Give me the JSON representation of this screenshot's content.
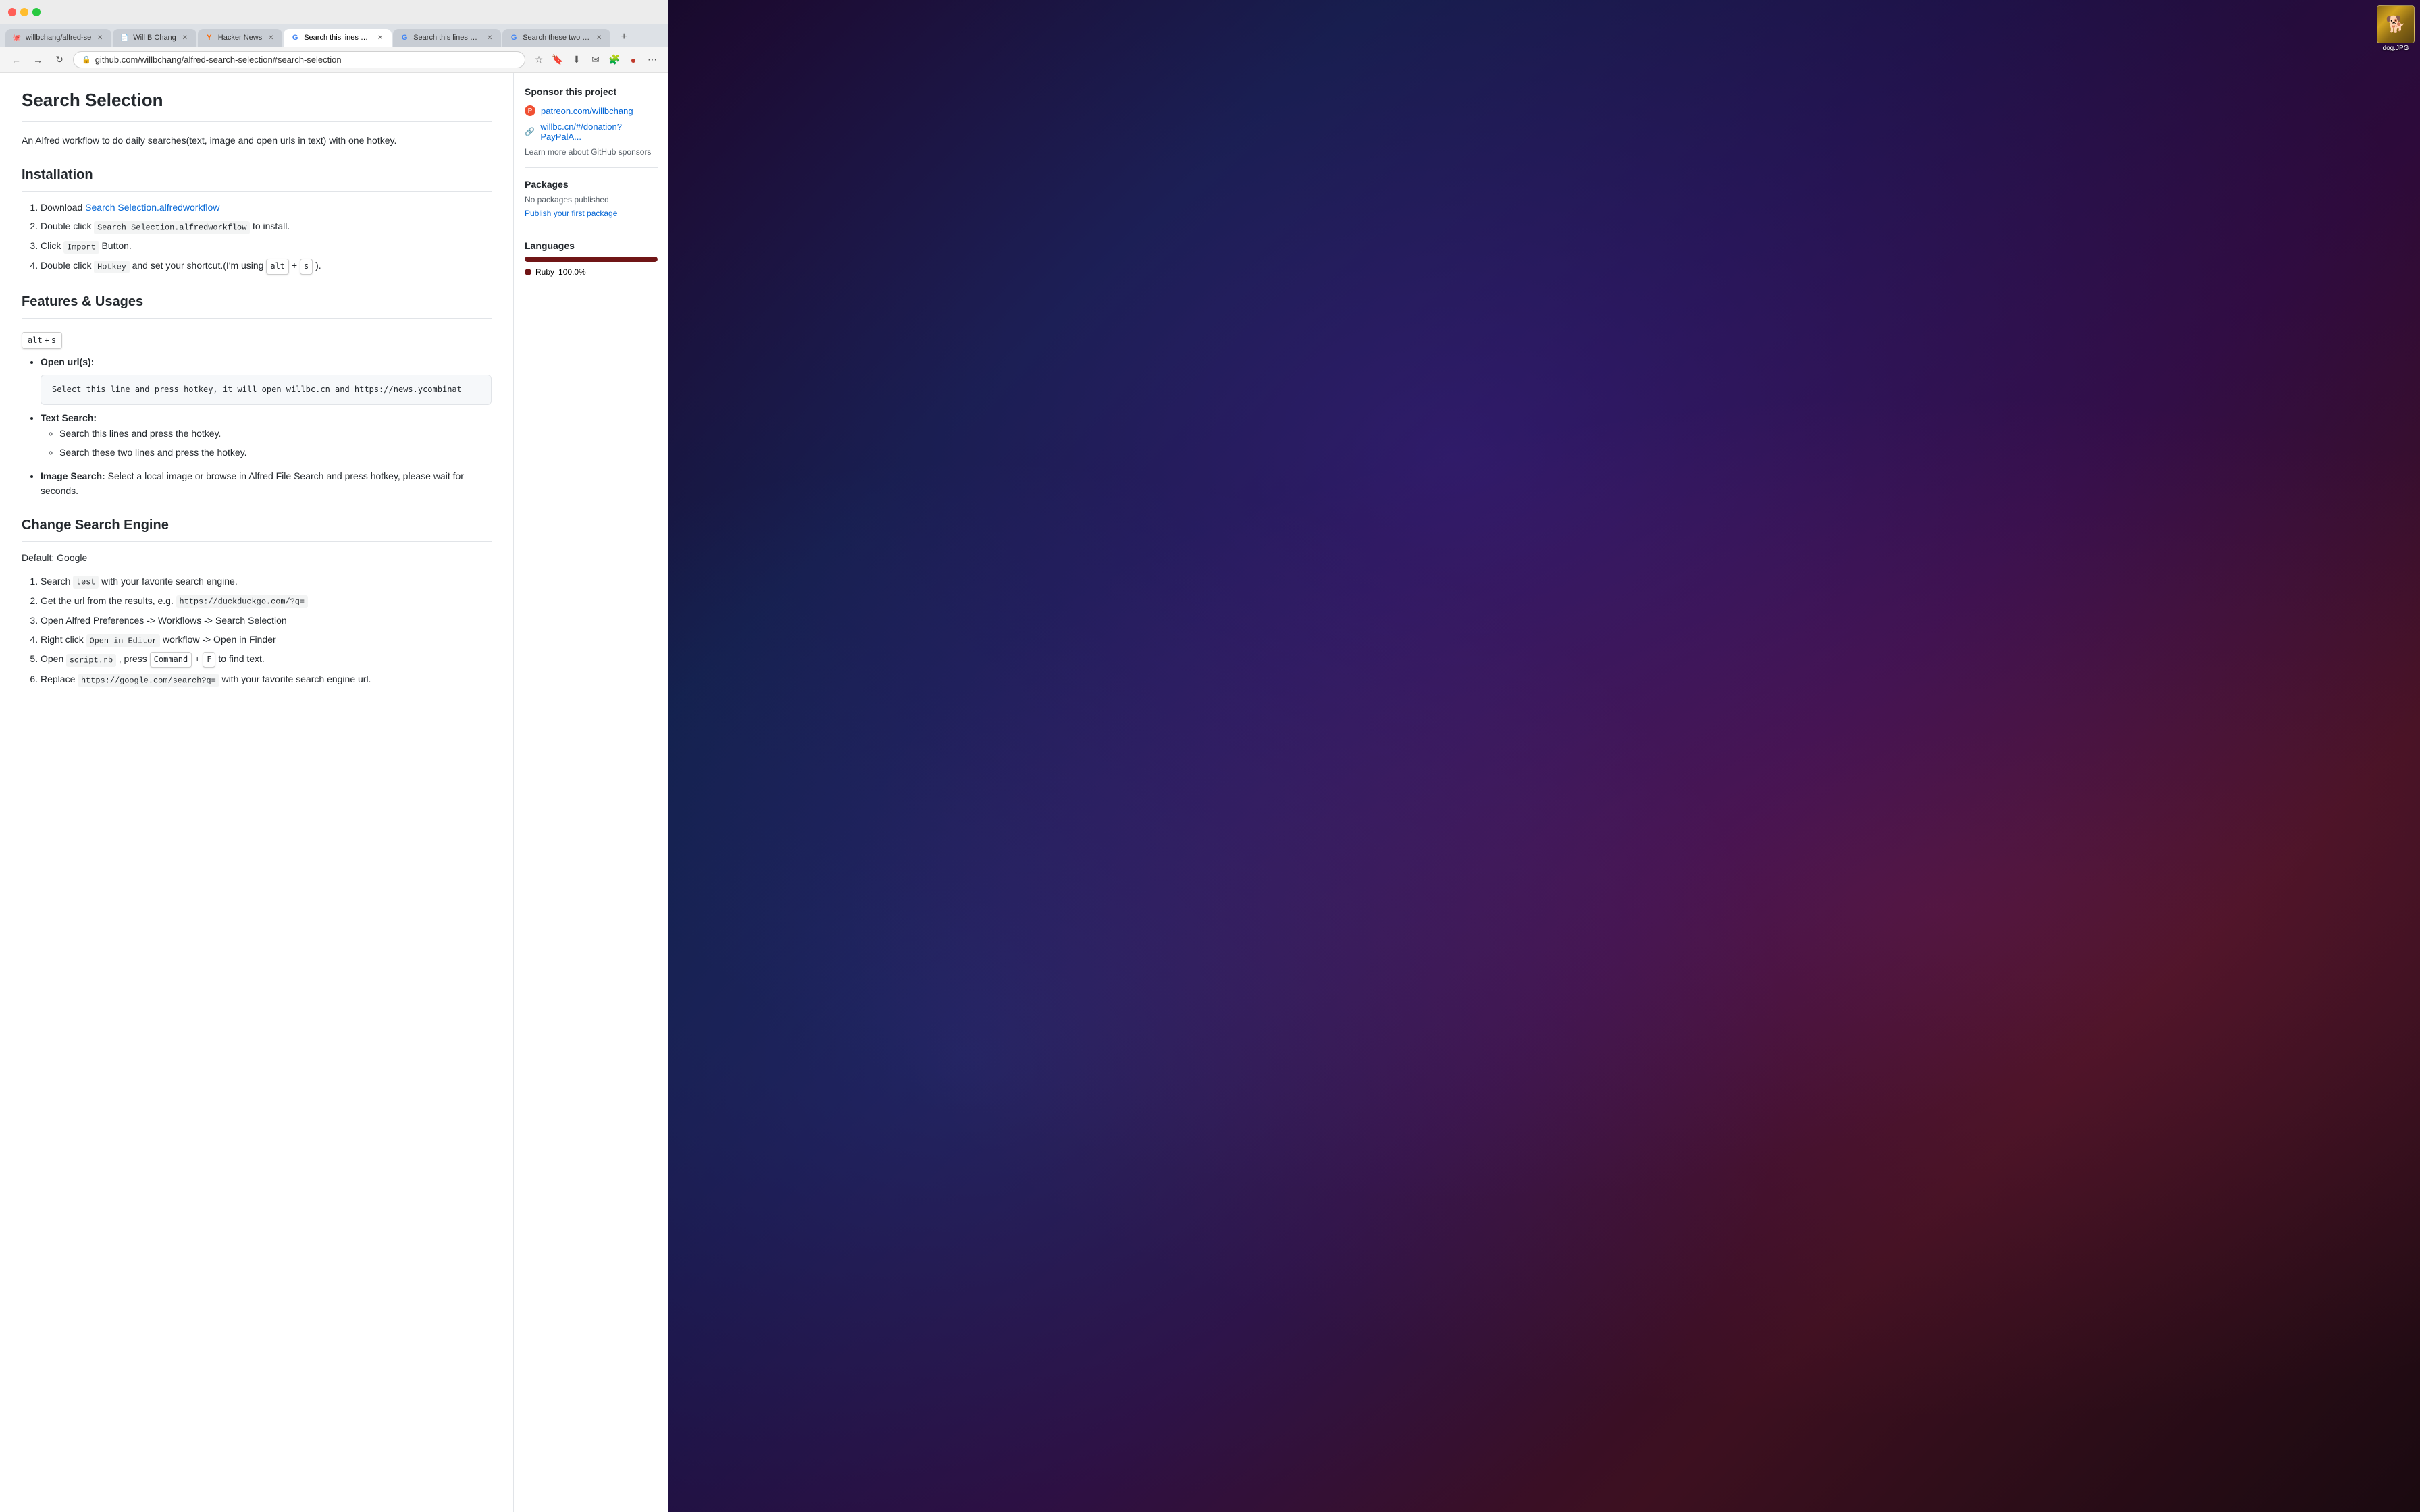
{
  "desktop": {
    "dog_label": "dog.JPG"
  },
  "browser": {
    "tabs": [
      {
        "id": "tab1",
        "favicon": "🐙",
        "title": "willbchang/alfred-se",
        "active": false
      },
      {
        "id": "tab2",
        "favicon": "📄",
        "title": "Will B Chang",
        "active": false
      },
      {
        "id": "tab3",
        "favicon": "Y",
        "title": "Hacker News",
        "active": false
      },
      {
        "id": "tab4",
        "favicon": "G",
        "title": "Search this lines and",
        "active": true
      },
      {
        "id": "tab5",
        "favicon": "G",
        "title": "Search this lines and",
        "active": false
      },
      {
        "id": "tab6",
        "favicon": "G",
        "title": "Search these two lin...",
        "active": false
      }
    ],
    "url": "github.com/willbchang/alfred-search-selection#search-selection"
  },
  "page": {
    "title": "Search Selection",
    "description": "An Alfred workflow to do daily searches(text, image and open urls in text) with one hotkey.",
    "sections": {
      "installation": {
        "heading": "Installation",
        "steps": [
          {
            "text": "Download ",
            "link": "Search Selection.alfredworkflow",
            "after": ""
          },
          {
            "text": "Double click ",
            "code": "Search Selection.alfredworkflow",
            "after": " to install."
          },
          {
            "text": "Click ",
            "code": "Import",
            "after": " Button."
          },
          {
            "text": "Double click ",
            "code": "Hotkey",
            "after": " and set your shortcut.(I'm using ",
            "keys": [
              "alt",
              "+",
              "s"
            ],
            "end": ")."
          }
        ]
      },
      "features": {
        "heading": "Features & Usages",
        "shortcut": "alt + s",
        "items": [
          {
            "label": "Open url(s):",
            "code_example": "Select this line and press hotkey, it will open willbc.cn and https://news.ycombinat"
          },
          {
            "label": "Text Search:",
            "sub_items": [
              "Search this lines and press the hotkey.",
              "Search these two lines and press the hotkey."
            ]
          },
          {
            "label": "Image Search:",
            "label_bold": "Image Search",
            "text": "Select a local image or browse in Alfred File Search and press hotkey, please wait for seconds."
          }
        ]
      },
      "change_engine": {
        "heading": "Change Search Engine",
        "default_text": "Default: Google",
        "steps": [
          {
            "text": "Search ",
            "code": "test",
            "after": " with your favorite search engine."
          },
          {
            "text": "Get the url from the results, e.g. ",
            "code": "https://duckduckgo.com/?q=",
            "after": ""
          },
          {
            "text": "Open Alfred Preferences -> Workflows -> Search Selection",
            "after": ""
          },
          {
            "text": "Right click ",
            "code": "Open in Editor",
            "after": " workflow -> Open in Finder"
          },
          {
            "text": "Open ",
            "code": "script.rb",
            "after": " , press ",
            "keys": [
              "Command",
              "+",
              "F"
            ],
            "end": " to find text."
          },
          {
            "text": "Replace ",
            "code": "https://google.com/search?q=",
            "after": " with your favorite search engine url."
          }
        ]
      }
    },
    "sidebar": {
      "sponsor": {
        "heading": "Sponsor this project",
        "links": [
          {
            "icon": "patreon",
            "url": "patreon.com/willbchang"
          },
          {
            "icon": "link",
            "url": "willbc.cn/#/donation?PayPalA..."
          }
        ],
        "learn_more_prefix": "Learn more about ",
        "learn_more_link": "GitHub sponsors"
      },
      "packages": {
        "heading": "Packages",
        "empty_text": "No packages published",
        "publish_link": "Publish your first package"
      },
      "languages": {
        "heading": "Languages",
        "items": [
          {
            "name": "Ruby",
            "percent": "100.0%",
            "color": "#701516"
          }
        ]
      }
    }
  }
}
